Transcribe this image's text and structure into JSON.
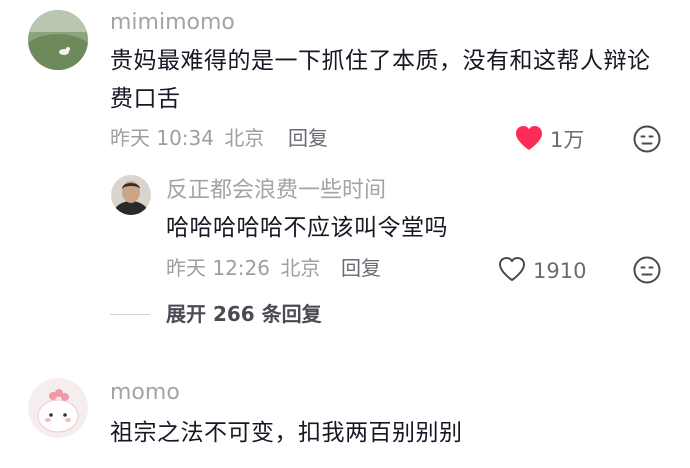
{
  "comments": [
    {
      "username": "mimimomo",
      "text_line1": "贵妈最难得的是一下抓住了本质，没有和这帮人辩论",
      "text_line2": "费口舌",
      "time": "昨天 10:34",
      "location": "北京",
      "reply_label": "回复",
      "likes": "1万",
      "liked": true,
      "replies": [
        {
          "username": "反正都会浪费一些时间",
          "text": "哈哈哈哈哈不应该叫令堂吗",
          "time": "昨天 12:26",
          "location": "北京",
          "reply_label": "回复",
          "likes": "1910",
          "liked": false
        }
      ],
      "expand_label": "展开 266 条回复"
    },
    {
      "username": "momo",
      "text": "祖宗之法不可变，扣我两百别别别"
    }
  ],
  "colors": {
    "liked_heart": "#fe2c55",
    "username": "#a3a3a8",
    "text": "#161823",
    "meta": "#9e9ea3"
  },
  "icons": {
    "like": "heart-icon",
    "dislike": "dislike-face-icon"
  }
}
